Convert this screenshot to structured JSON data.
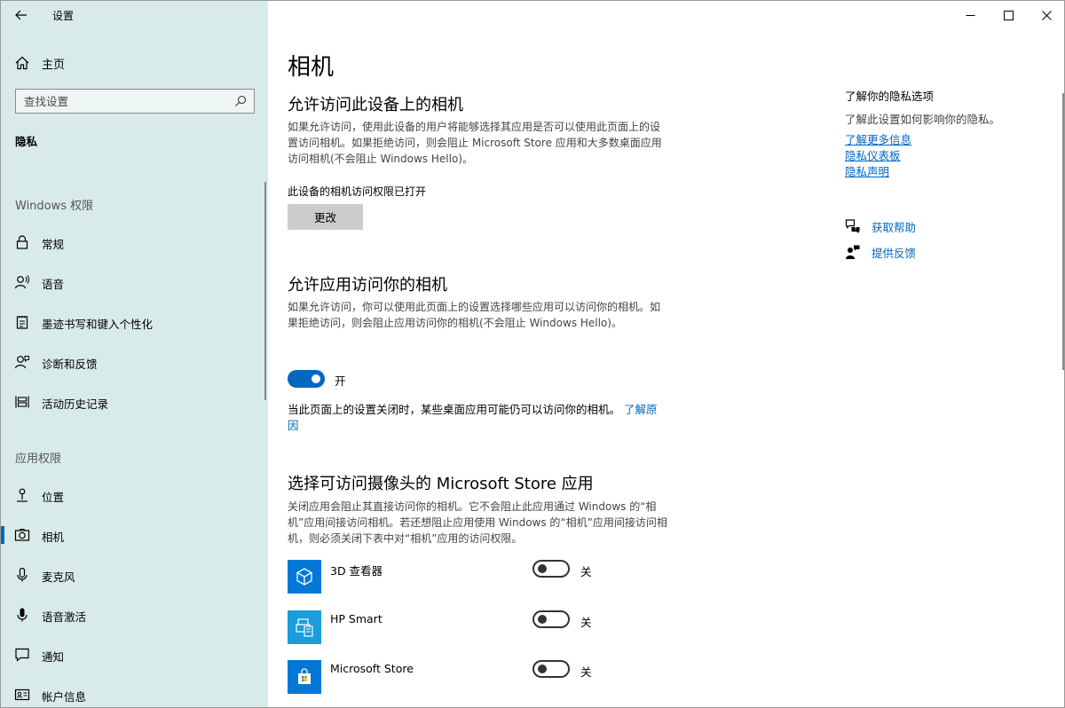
{
  "window": {
    "title": "设置"
  },
  "sidebar": {
    "home_label": "主页",
    "search_placeholder": "查找设置",
    "current_section": "隐私",
    "windows_permissions_label": "Windows 权限",
    "windows_permissions": [
      {
        "label": "常规",
        "icon": "lock-icon"
      },
      {
        "label": "语音",
        "icon": "speech-icon"
      },
      {
        "label": "墨迹书写和键入个性化",
        "icon": "notepad-icon"
      },
      {
        "label": "诊断和反馈",
        "icon": "diagnostics-icon"
      },
      {
        "label": "活动历史记录",
        "icon": "activity-history-icon"
      }
    ],
    "app_permissions_label": "应用权限",
    "app_permissions": [
      {
        "label": "位置",
        "icon": "location-icon"
      },
      {
        "label": "相机",
        "icon": "camera-icon",
        "active": true
      },
      {
        "label": "麦克风",
        "icon": "microphone-icon"
      },
      {
        "label": "语音激活",
        "icon": "voice-activation-icon"
      },
      {
        "label": "通知",
        "icon": "notification-icon"
      },
      {
        "label": "帐户信息",
        "icon": "account-info-icon"
      }
    ]
  },
  "main": {
    "page_title": "相机",
    "device_access": {
      "heading": "允许访问此设备上的相机",
      "description": "如果允许访问，使用此设备的用户将能够选择其应用是否可以使用此页面上的设置访问相机。如果拒绝访问，则会阻止 Microsoft Store 应用和大多数桌面应用访问相机(不会阻止 Windows Hello)。",
      "status": "此设备的相机访问权限已打开",
      "change_button": "更改"
    },
    "app_access": {
      "heading": "允许应用访问你的相机",
      "description": "如果允许访问，你可以使用此页面上的设置选择哪些应用可以访问你的相机。如果拒绝访问，则会阻止应用访问你的相机(不会阻止 Windows Hello)。",
      "toggle_on": true,
      "toggle_label": "开",
      "note": "当此页面上的设置关闭时，某些桌面应用可能仍可以访问你的相机。",
      "note_link": "了解原因"
    },
    "store_apps": {
      "heading": "选择可访问摄像头的 Microsoft Store 应用",
      "description": "关闭应用会阻止其直接访问你的相机。它不会阻止此应用通过 Windows 的“相机”应用间接访问相机。若还想阻止应用使用 Windows 的“相机”应用间接访问相机，则必须关闭下表中对“相机”应用的访问权限。",
      "apps": [
        {
          "name": "3D 查看器",
          "icon": "3d-viewer-icon",
          "on": false,
          "toggle_label": "关"
        },
        {
          "name": "HP Smart",
          "icon": "hp-smart-icon",
          "on": false,
          "toggle_label": "关"
        },
        {
          "name": "Microsoft Store",
          "icon": "store-icon",
          "on": false,
          "toggle_label": "关"
        }
      ]
    }
  },
  "right_panel": {
    "title": "了解你的隐私选项",
    "description": "了解此设置如何影响你的隐私。",
    "links": [
      "了解更多信息",
      "隐私仪表板",
      "隐私声明"
    ],
    "help_label": "获取帮助",
    "feedback_label": "提供反馈"
  },
  "colors": {
    "accent": "#0067c0",
    "sidebar_bg": "#d9ebe8",
    "app_tile": "#0078d7"
  }
}
